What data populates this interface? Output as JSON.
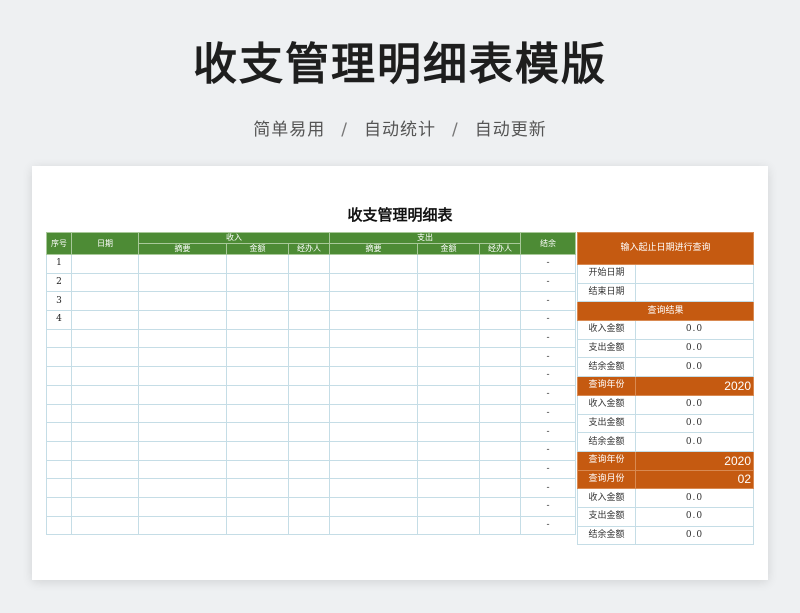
{
  "hero": {
    "title": "收支管理明细表模版",
    "sub1": "简单易用",
    "sep": "/",
    "sub2": "自动统计",
    "sub3": "自动更新"
  },
  "sheet": {
    "title": "收支管理明细表",
    "headers": {
      "seq": "序号",
      "date": "日期",
      "income": "收入",
      "expense": "支出",
      "balance": "结余",
      "summary": "摘要",
      "amount": "金额",
      "handler": "经办人"
    },
    "rows": [
      {
        "seq": "1",
        "bal": "-"
      },
      {
        "seq": "2",
        "bal": "-"
      },
      {
        "seq": "3",
        "bal": "-"
      },
      {
        "seq": "4",
        "bal": "-"
      },
      {
        "seq": "",
        "bal": "-"
      },
      {
        "seq": "",
        "bal": "-"
      },
      {
        "seq": "",
        "bal": "-"
      },
      {
        "seq": "",
        "bal": "-"
      },
      {
        "seq": "",
        "bal": "-"
      },
      {
        "seq": "",
        "bal": "-"
      },
      {
        "seq": "",
        "bal": "-"
      },
      {
        "seq": "",
        "bal": "-"
      },
      {
        "seq": "",
        "bal": "-"
      },
      {
        "seq": "",
        "bal": "-"
      },
      {
        "seq": "",
        "bal": "-"
      }
    ]
  },
  "query": {
    "header": "输入起止日期进行查询",
    "start_label": "开始日期",
    "start_value": "",
    "end_label": "结束日期",
    "end_value": "",
    "result_header": "查询结果",
    "r1": {
      "income_label": "收入金额",
      "income": "0.0",
      "expense_label": "支出金额",
      "expense": "0.0",
      "balance_label": "结余金额",
      "balance": "0.0"
    },
    "year_label": "查询年份",
    "year_value": "2020",
    "r2": {
      "income_label": "收入金额",
      "income": "0.0",
      "expense_label": "支出金额",
      "expense": "0.0",
      "balance_label": "结余金额",
      "balance": "0.0"
    },
    "year2_label": "查询年份",
    "year2_value": "2020",
    "month_label": "查询月份",
    "month_value": "02",
    "r3": {
      "income_label": "收入金额",
      "income": "0.0",
      "expense_label": "支出金额",
      "expense": "0.0",
      "balance_label": "结余金额",
      "balance": "0.0"
    }
  },
  "colors": {
    "green": "#4d8b35",
    "orange": "#c55a11",
    "grid": "#c5dde6"
  }
}
